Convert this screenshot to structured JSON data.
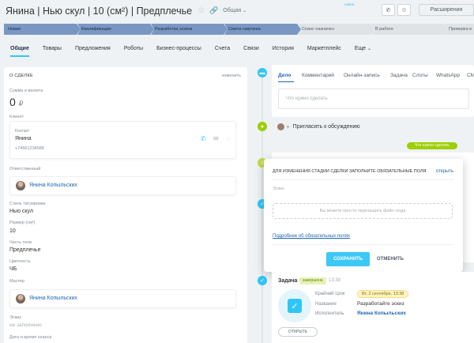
{
  "header": {
    "title": "Янина | Нью скул | 10 (см²) | Предплечье",
    "category": "Общая",
    "extensions_label": "Расширения"
  },
  "pipeline": [
    {
      "label": "Новая",
      "state": "active"
    },
    {
      "label": "Квалификация",
      "state": "active"
    },
    {
      "label": "Разработка эскиза",
      "state": "active"
    },
    {
      "label": "Смета озвучена",
      "state": "active"
    },
    {
      "label": "Сеанс назначен",
      "state": "inactive"
    },
    {
      "label": "В работе",
      "state": "inactive"
    },
    {
      "label": "Проверка в",
      "state": "inactive"
    }
  ],
  "tabs": [
    "Общие",
    "Товары",
    "Предложения",
    "Роботы",
    "Бизнес-процессы",
    "Счета",
    "Связи",
    "История",
    "Маркетплейс",
    "Еще"
  ],
  "deal": {
    "section_title": "О СДЕЛКЕ",
    "edit_label": "изменить",
    "amount_label": "Сумма и валюта",
    "amount_value": "0",
    "currency": "₽",
    "client_label": "Клиент",
    "contact_label": "Контакт",
    "contact_name": "Янина",
    "contact_phone": "+74561234589",
    "responsible_label": "Ответственный",
    "responsible_name": "Янина Копыльских",
    "style_label": "Стиль татуировки",
    "style_value": "Нью скул",
    "size_label": "Размер (см²)",
    "size_value": "10",
    "body_part_label": "Часть тела",
    "body_part_value": "Предплечье",
    "color_label": "Цветность",
    "color_value": "ЧБ",
    "master_label": "Мастер",
    "master_name": "Янина Копыльских",
    "sketch_label": "Эскиз",
    "sketch_value": "не заполнено",
    "datetime_label": "Дата и время сеанса"
  },
  "activity": {
    "tabs": [
      "Дело",
      "Комментарий",
      "Онлайн-запись",
      "Задача",
      "Слоты",
      "WhatsApp",
      "СМ"
    ],
    "new_badge": "новое",
    "placeholder": "Что нужно сделать",
    "invite_label": "Пригласить к обсуждению",
    "todo_badge": "Что нужно сделать"
  },
  "popup": {
    "heading": "ДЛЯ ИЗМЕНЕНИЯ СТАДИИ СДЕЛКИ ЗАПОЛНИТЕ ОБЯЗАТЕЛЬНЫЕ ПОЛЯ",
    "open_label": "открыть",
    "field_label": "Эскиз",
    "dropzone_text": "Вы можете просто перетащить файл сюда",
    "more_link": "Подробнее об обязательных полях",
    "save_label": "СОХРАНИТЬ",
    "cancel_label": "ОТМЕНИТЬ"
  },
  "task": {
    "title": "Задача",
    "status": "завершена",
    "time": "13:38",
    "deadline_label": "Крайний срок",
    "deadline_value": "Вт, 2 сентября, 13:38",
    "name_label": "Название",
    "name_value": "Разработайте эскиз",
    "executor_label": "Исполнитель",
    "executor_value": "Янина Копыльских",
    "open_button": "ОТКРЫТЬ"
  },
  "colors": {
    "accent": "#2fc6f6",
    "stage_active": "#7a97c3",
    "stage_inactive": "#dfe3e6",
    "link": "#2067b0",
    "green": "#9dcf00"
  }
}
